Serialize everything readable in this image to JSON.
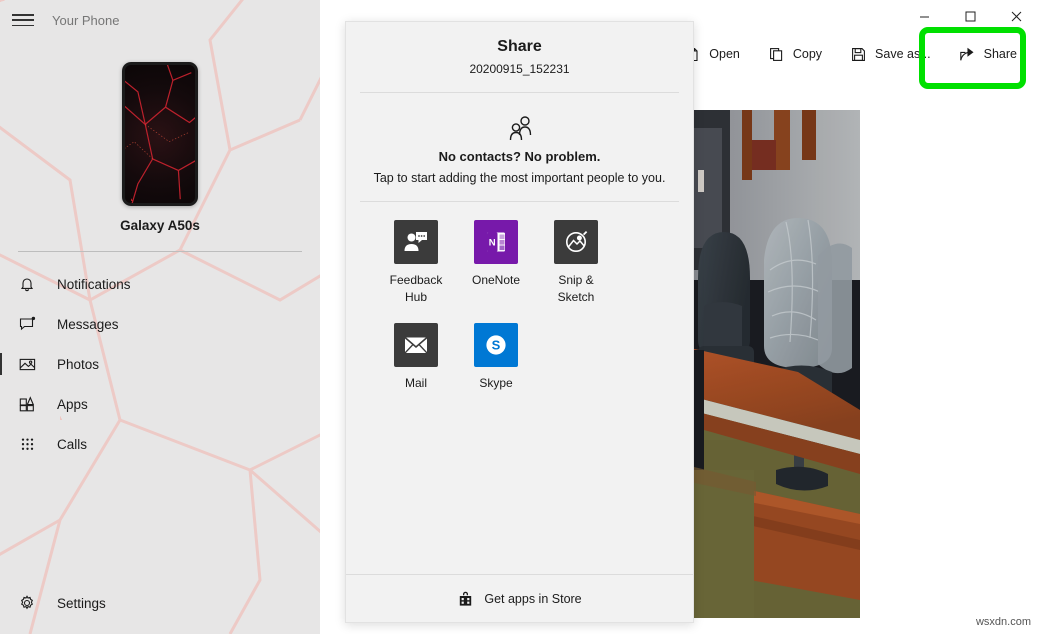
{
  "window": {
    "app_title": "Your Phone",
    "menu_icon": "hamburger-icon",
    "controls": {
      "minimize": "—",
      "maximize": "☐",
      "close": "✕"
    }
  },
  "sidebar": {
    "device": {
      "name": "Galaxy A50s",
      "thumbnail": "phone-wallpaper-thumbnail"
    },
    "items": [
      {
        "label": "Notifications",
        "icon": "bell-icon",
        "selected": false
      },
      {
        "label": "Messages",
        "icon": "message-bubble-icon",
        "selected": false
      },
      {
        "label": "Photos",
        "icon": "photo-icon",
        "selected": true
      },
      {
        "label": "Apps",
        "icon": "apps-grid-icon",
        "selected": false
      },
      {
        "label": "Calls",
        "icon": "dialpad-icon",
        "selected": false
      }
    ],
    "settings": {
      "label": "Settings",
      "icon": "gear-icon"
    }
  },
  "toolbar": {
    "buttons": [
      {
        "label": "Open",
        "icon": "open-icon",
        "highlighted": false
      },
      {
        "label": "Copy",
        "icon": "copy-icon",
        "highlighted": false
      },
      {
        "label": "Save as...",
        "icon": "save-icon",
        "highlighted": false
      },
      {
        "label": "Share",
        "icon": "share-icon",
        "highlighted": true
      }
    ],
    "highlight_color": "#00e000"
  },
  "share_panel": {
    "title": "Share",
    "subtitle": "20200915_152231",
    "contacts": {
      "icon": "people-icon",
      "heading": "No contacts? No problem.",
      "description": "Tap to start adding the most important people to you."
    },
    "apps": [
      {
        "label": "Feedback Hub",
        "icon": "feedback-hub-icon",
        "color": "#3b3b3b"
      },
      {
        "label": "OneNote",
        "icon": "onenote-icon",
        "color": "#7719aa"
      },
      {
        "label": "Snip & Sketch",
        "icon": "snip-sketch-icon",
        "color": "#3b3b3b"
      },
      {
        "label": "Mail",
        "icon": "mail-icon",
        "color": "#3b3b3b"
      },
      {
        "label": "Skype",
        "icon": "skype-icon",
        "color": "#0078d4"
      }
    ],
    "footer": {
      "label": "Get apps in Store",
      "icon": "store-bag-icon"
    }
  },
  "photo": {
    "description": "office-chairs-and-desk-photo"
  },
  "watermark": "wsxdn.com"
}
